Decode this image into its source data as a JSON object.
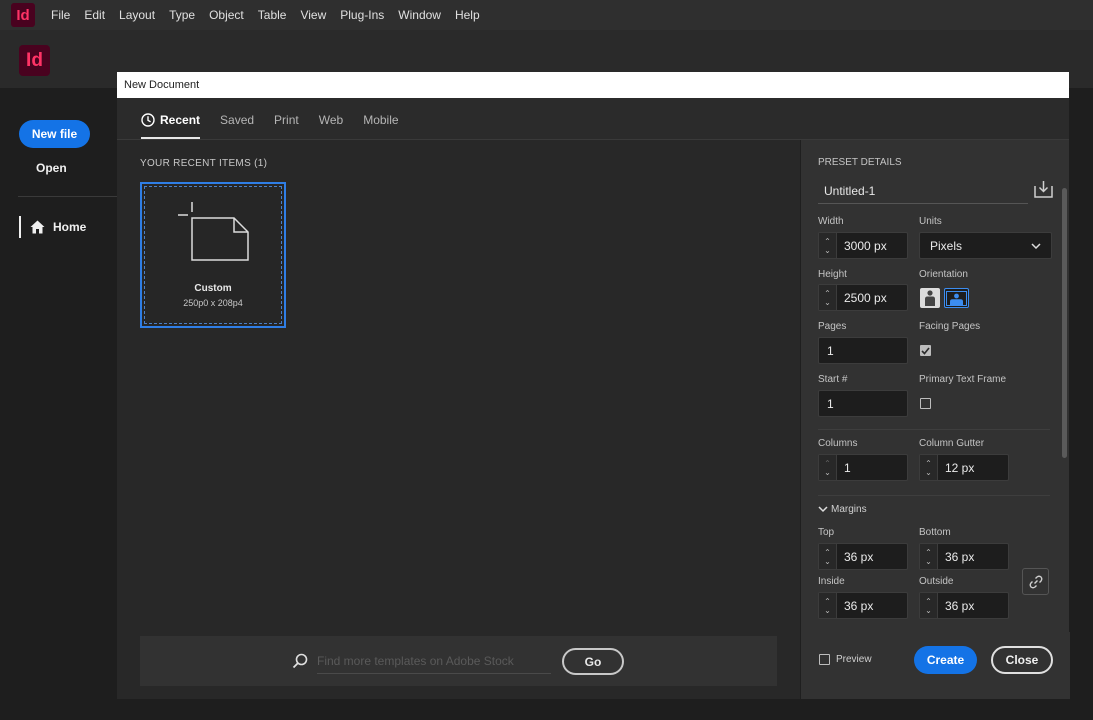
{
  "app": {
    "logo_text": "Id",
    "menu": [
      "File",
      "Edit",
      "Layout",
      "Type",
      "Object",
      "Table",
      "View",
      "Plug-Ins",
      "Window",
      "Help"
    ]
  },
  "home": {
    "logo_text": "Id",
    "new_file_label": "New file",
    "open_label": "Open",
    "home_label": "Home"
  },
  "dialog": {
    "title": "New Document",
    "tabs": [
      "Recent",
      "Saved",
      "Print",
      "Web",
      "Mobile"
    ],
    "active_tab": "Recent",
    "recent_header": "YOUR RECENT ITEMS  (1)",
    "recent_items": [
      {
        "name": "Custom",
        "size": "250p0 x 208p4"
      }
    ],
    "stock": {
      "placeholder": "Find more templates on Adobe Stock",
      "go_label": "Go"
    },
    "preset": {
      "section_label": "PRESET DETAILS",
      "name": "Untitled-1",
      "width_label": "Width",
      "width": "3000 px",
      "units_label": "Units",
      "units": "Pixels",
      "height_label": "Height",
      "height": "2500 px",
      "orientation_label": "Orientation",
      "orientation": "landscape",
      "pages_label": "Pages",
      "pages": "1",
      "facing_pages_label": "Facing Pages",
      "facing_pages": true,
      "start_label": "Start #",
      "start": "1",
      "primary_text_frame_label": "Primary Text Frame",
      "primary_text_frame": false,
      "columns_label": "Columns",
      "columns": "1",
      "column_gutter_label": "Column Gutter",
      "column_gutter": "12 px",
      "margins_label": "Margins",
      "top_label": "Top",
      "top": "36 px",
      "bottom_label": "Bottom",
      "bottom": "36 px",
      "inside_label": "Inside",
      "inside": "36 px",
      "outside_label": "Outside",
      "outside": "36 px"
    },
    "preview_label": "Preview",
    "preview_checked": false,
    "create_label": "Create",
    "close_label": "Close"
  },
  "colors": {
    "accent": "#1473e6",
    "brand": "#ff3366",
    "brand_bg": "#49021f"
  }
}
